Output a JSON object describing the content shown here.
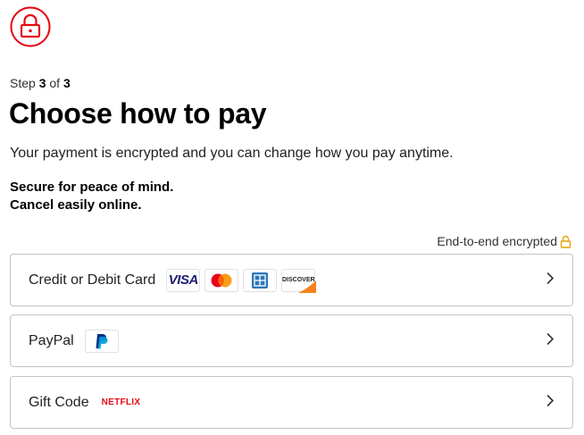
{
  "header": {
    "step_prefix": "Step",
    "step_current": "3",
    "step_sep": "of",
    "step_total": "3",
    "title": "Choose how to pay",
    "subtitle": "Your payment is encrypted and you can change how you pay anytime.",
    "secure_line1": "Secure for peace of mind.",
    "secure_line2": "Cancel easily online."
  },
  "encryption": {
    "label": "End-to-end encrypted"
  },
  "options": [
    {
      "label": "Credit or Debit Card",
      "logos": [
        "VISA",
        "mastercard",
        "amex",
        "DISCOVER"
      ]
    },
    {
      "label": "PayPal",
      "logos": [
        "paypal"
      ]
    },
    {
      "label": "Gift Code",
      "logos": [
        "NETFLIX"
      ]
    }
  ],
  "colors": {
    "brand_red": "#e50914",
    "lock_gold": "#e5a000",
    "border": "#c4c4c4"
  },
  "icons": {
    "badge": "lock-circle-icon",
    "enc": "padlock-icon",
    "chevron": "chevron-right-icon"
  }
}
